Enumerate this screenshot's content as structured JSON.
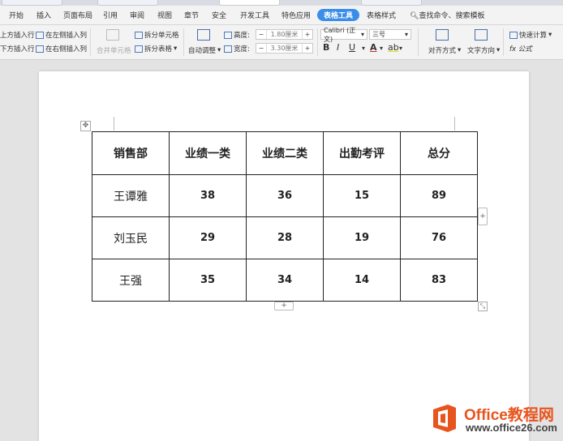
{
  "menu": {
    "items": [
      "开始",
      "插入",
      "页面布局",
      "引用",
      "审阅",
      "视图",
      "章节",
      "安全",
      "开发工具",
      "特色应用",
      "表格工具",
      "表格样式"
    ],
    "active": "表格工具",
    "search": "查找命令、搜索模板"
  },
  "toolbar": {
    "insert_above": "上方插入行",
    "insert_below": "下方插入行",
    "insert_left": "在左侧插入列",
    "insert_right": "在右侧插入列",
    "merge_cells": "合并单元格",
    "split_cells": "拆分单元格",
    "split_table": "拆分表格",
    "auto_fit": "自动调整",
    "height_label": "高度:",
    "height_value": "1.80厘米",
    "width_label": "宽度:",
    "width_value": "3.30厘米",
    "font_name": "Calibri (正文)",
    "font_size": "三号",
    "bold": "B",
    "italic": "I",
    "underline": "U",
    "font_color": "A",
    "highlight": "ab",
    "align": "对齐方式",
    "text_direction": "文字方向",
    "quick_calc": "快速计算",
    "formula": "fx 公式"
  },
  "table": {
    "headers": [
      "销售部",
      "业绩一类",
      "业绩二类",
      "出勤考评",
      "总分"
    ],
    "rows": [
      [
        "王谭雅",
        "38",
        "36",
        "15",
        "89"
      ],
      [
        "刘玉民",
        "29",
        "28",
        "19",
        "76"
      ],
      [
        "王强",
        "35",
        "34",
        "14",
        "83"
      ]
    ]
  },
  "watermark": {
    "title": "Office教程网",
    "url": "www.office26.com"
  },
  "colors": {
    "accent": "#3a8de8",
    "brand_orange": "#e8541e"
  }
}
